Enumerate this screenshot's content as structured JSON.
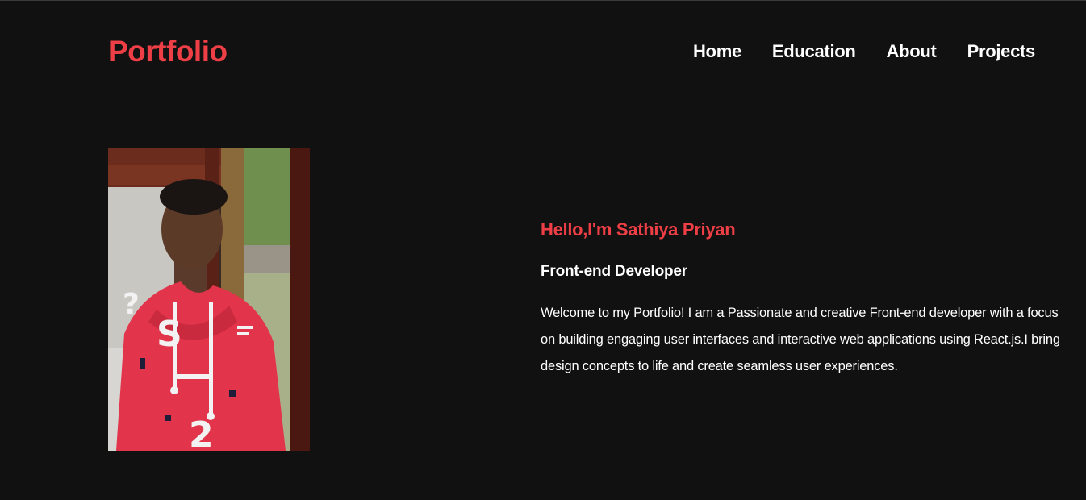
{
  "header": {
    "brand": "Portfolio",
    "nav": {
      "home": "Home",
      "education": "Education",
      "about": "About",
      "projects": "Projects"
    }
  },
  "hero": {
    "greeting": "Hello,I'm Sathiya Priyan",
    "role": "Front-end Developer",
    "bio": "Welcome to my Portfolio! I am a Passionate and creative Front-end developer with a focus on building engaging user interfaces and interactive web applications using React.js.I bring design concepts to life and create seamless user experiences."
  },
  "colors": {
    "background": "#111111",
    "accent": "#ee3f46",
    "text": "#ffffff"
  }
}
